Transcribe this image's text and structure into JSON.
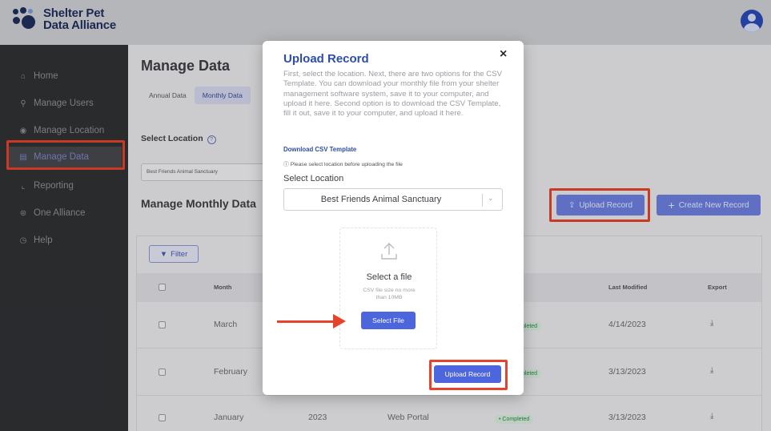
{
  "brand": {
    "line1": "Shelter Pet",
    "line2": "Data Alliance"
  },
  "sidebar": {
    "items": [
      {
        "icon": "home-icon",
        "glyph": "⌂",
        "label": "Home"
      },
      {
        "icon": "user-icon",
        "glyph": "⚲",
        "label": "Manage Users"
      },
      {
        "icon": "location-icon",
        "glyph": "◉",
        "label": "Manage Location"
      },
      {
        "icon": "database-icon",
        "glyph": "▤",
        "label": "Manage Data"
      },
      {
        "icon": "chart-icon",
        "glyph": "⌞",
        "label": "Reporting"
      },
      {
        "icon": "alliance-icon",
        "glyph": "⊛",
        "label": "One Alliance"
      },
      {
        "icon": "help-icon",
        "glyph": "◷",
        "label": "Help"
      }
    ]
  },
  "page": {
    "title": "Manage Data",
    "tabs": [
      "Annual Data",
      "Monthly Data"
    ],
    "select_location_label": "Select Location",
    "location_value": "Best Friends Animal Sanctuary",
    "section_title": "Manage Monthly Data",
    "upload_button": "Upload Record",
    "create_button": "Create New Record",
    "filter_button": "Filter"
  },
  "table": {
    "headers": {
      "month": "Month",
      "last_modified": "Last Modified",
      "export": "Export"
    },
    "rows": [
      {
        "month": "March",
        "year": "",
        "source": "",
        "status": "pleted",
        "last_modified": "4/14/2023"
      },
      {
        "month": "February",
        "year": "",
        "source": "",
        "status": "pleted",
        "last_modified": "3/13/2023"
      },
      {
        "month": "January",
        "year": "2023",
        "source": "Web Portal",
        "status": "• Completed",
        "last_modified": "3/13/2023"
      }
    ]
  },
  "modal": {
    "title": "Upload Record",
    "close": "×",
    "description": "First, select the location. Next, there are two options for the CSV Template. You can download your monthly file from your shelter management software system, save it to your computer, and upload it here. Second option is to download the CSV Template, fill it out, save it to your computer, and upload it here.",
    "download_link": "Download CSV Template",
    "note": "Please select location before uploading the file",
    "select_location_label": "Select Location",
    "location_value": "Best Friends Animal Sanctuary",
    "dropzone_title": "Select a file",
    "dropzone_subtitle": "CSV file size no more than 10MB",
    "select_file_button": "Select File",
    "upload_button": "Upload Record"
  },
  "colors": {
    "highlight": "#e5432c",
    "primary_button": "#4d66dd",
    "heading_blue": "#2d4ea6",
    "sidebar_bg": "#303134"
  }
}
